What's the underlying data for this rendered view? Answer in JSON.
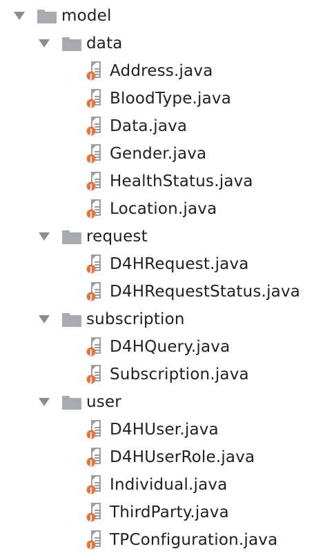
{
  "tree": [
    {
      "kind": "folder",
      "label": "model",
      "level": 0,
      "expanded": true
    },
    {
      "kind": "folder",
      "label": "data",
      "level": 1,
      "expanded": true
    },
    {
      "kind": "file",
      "label": "Address.java",
      "level": 2
    },
    {
      "kind": "file",
      "label": "BloodType.java",
      "level": 2
    },
    {
      "kind": "file",
      "label": "Data.java",
      "level": 2
    },
    {
      "kind": "file",
      "label": "Gender.java",
      "level": 2
    },
    {
      "kind": "file",
      "label": "HealthStatus.java",
      "level": 2
    },
    {
      "kind": "file",
      "label": "Location.java",
      "level": 2
    },
    {
      "kind": "folder",
      "label": "request",
      "level": 1,
      "expanded": true
    },
    {
      "kind": "file",
      "label": "D4HRequest.java",
      "level": 2
    },
    {
      "kind": "file",
      "label": "D4HRequestStatus.java",
      "level": 2
    },
    {
      "kind": "folder",
      "label": "subscription",
      "level": 1,
      "expanded": true
    },
    {
      "kind": "file",
      "label": "D4HQuery.java",
      "level": 2
    },
    {
      "kind": "file",
      "label": "Subscription.java",
      "level": 2
    },
    {
      "kind": "folder",
      "label": "user",
      "level": 1,
      "expanded": true
    },
    {
      "kind": "file",
      "label": "D4HUser.java",
      "level": 2
    },
    {
      "kind": "file",
      "label": "D4HUserRole.java",
      "level": 2
    },
    {
      "kind": "file",
      "label": "Individual.java",
      "level": 2
    },
    {
      "kind": "file",
      "label": "ThirdParty.java",
      "level": 2
    },
    {
      "kind": "file",
      "label": "TPConfiguration.java",
      "level": 2
    }
  ],
  "colors": {
    "arrow": "#8c8c8c",
    "folder": "#a7aab0",
    "file_page": "#9b9ea4",
    "java_badge": "#e8743b",
    "text": "#1f1f1f"
  },
  "icons": {
    "expand_arrow": "expand-arrow-icon",
    "folder": "folder-icon",
    "java_file": "java-file-icon"
  }
}
